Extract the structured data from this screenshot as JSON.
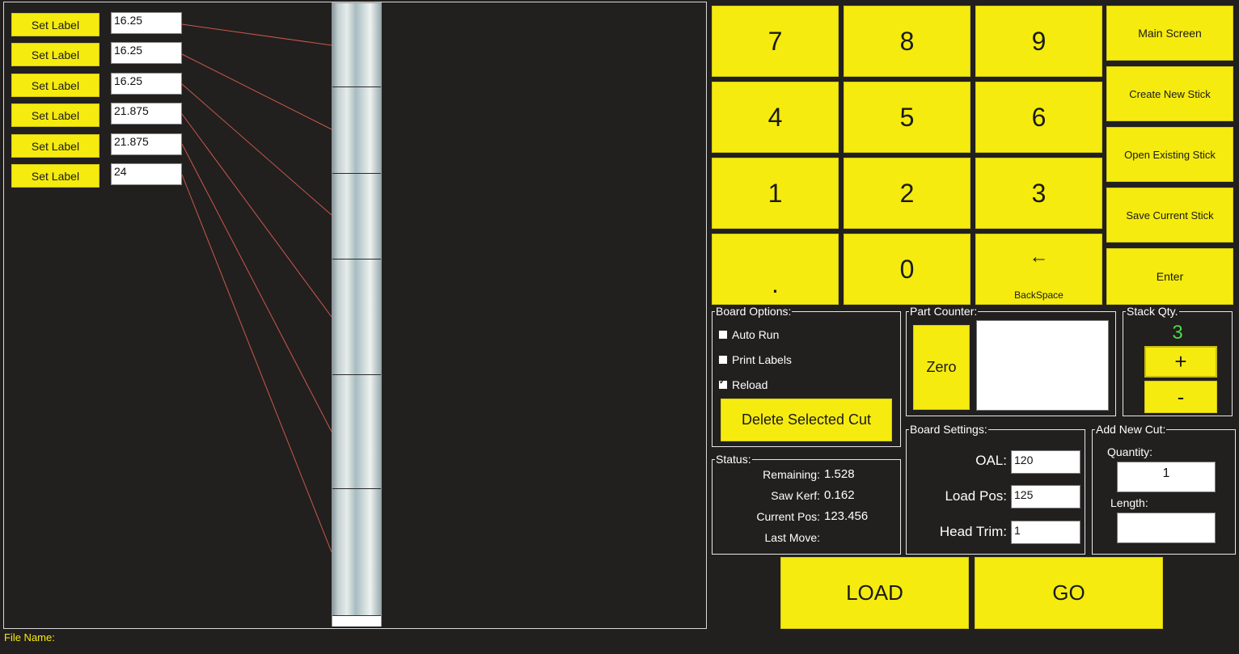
{
  "cut_list": {
    "set_label_text": "Set Label",
    "items": [
      {
        "value": "16.25"
      },
      {
        "value": "16.25"
      },
      {
        "value": "16.25"
      },
      {
        "value": "21.875"
      },
      {
        "value": "21.875"
      },
      {
        "value": "24"
      }
    ]
  },
  "keypad": {
    "keys": [
      "7",
      "8",
      "9",
      "4",
      "5",
      "6",
      "1",
      "2",
      "3",
      ".",
      "0"
    ],
    "backspace_glyph": "←",
    "backspace_label": "BackSpace"
  },
  "side_buttons": {
    "main_screen": "Main Screen",
    "create_new_stick": "Create New Stick",
    "open_existing_stick": "Open Existing Stick",
    "save_current_stick": "Save Current Stick",
    "enter": "Enter"
  },
  "board_options": {
    "title": "Board Options:",
    "auto_run": {
      "label": "Auto Run",
      "checked": false
    },
    "print_labels": {
      "label": "Print Labels",
      "checked": false
    },
    "reload": {
      "label": "Reload",
      "checked": true
    },
    "delete_cut": "Delete Selected Cut"
  },
  "part_counter": {
    "title": "Part Counter:",
    "zero": "Zero",
    "value": ""
  },
  "stack_qty": {
    "title": "Stack Qty.",
    "value": "3",
    "plus": "+",
    "minus": "-"
  },
  "status": {
    "title": "Status:",
    "remaining_label": "Remaining:",
    "remaining_value": "1.528",
    "saw_kerf_label": "Saw Kerf:",
    "saw_kerf_value": "0.162",
    "current_pos_label": "Current Pos:",
    "current_pos_value": "123.456",
    "last_move_label": "Last Move:",
    "last_move_value": ""
  },
  "board_settings": {
    "title": "Board Settings:",
    "oal_label": "OAL:",
    "oal_value": "120",
    "load_pos_label": "Load Pos:",
    "load_pos_value": "125",
    "head_trim_label": "Head Trim:",
    "head_trim_value": "1"
  },
  "add_new_cut": {
    "title": "Add New Cut:",
    "quantity_label": "Quantity:",
    "quantity_value": "1",
    "length_label": "Length:",
    "length_value": ""
  },
  "actions": {
    "load": "LOAD",
    "go": "GO"
  },
  "footer": {
    "file_name_label": "File Name:"
  },
  "colors": {
    "button_yellow": "#f5eb0f",
    "background": "#221f1f",
    "stack_qty_green": "#4cd94c",
    "leader_line": "#c85a4a"
  }
}
